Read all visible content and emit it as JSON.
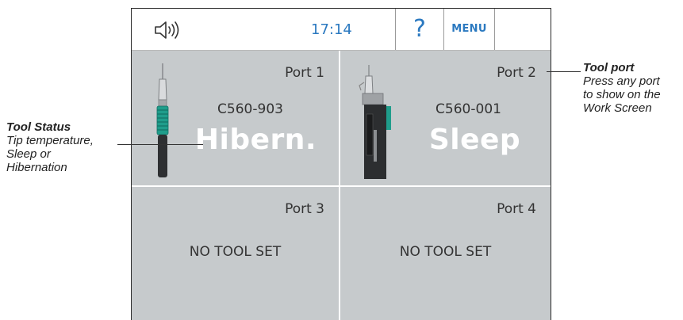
{
  "colors": {
    "accent": "#2b79c0",
    "tile": "#c6cacc",
    "status_text": "#ffffff"
  },
  "topbar": {
    "sound_icon": "speaker-icon",
    "time": "17:14",
    "help_label": "?",
    "menu_label": "MENU"
  },
  "ports": [
    {
      "name": "Port 1",
      "model": "C560-903",
      "status": "Hibern.",
      "tool_icon": "soldering-handpiece-icon"
    },
    {
      "name": "Port 2",
      "model": "C560-001",
      "status": "Sleep",
      "tool_icon": "tool-in-stand-icon"
    },
    {
      "name": "Port 3",
      "empty_label": "NO TOOL SET"
    },
    {
      "name": "Port 4",
      "empty_label": "NO TOOL SET"
    }
  ],
  "annotations": {
    "tool_status": {
      "title": "Tool Status",
      "body": [
        "Tip temperature,",
        "Sleep or",
        "Hibernation"
      ]
    },
    "tool_port": {
      "title": "Tool port",
      "body": [
        "Press any port",
        "to show on the",
        "Work Screen"
      ]
    }
  }
}
